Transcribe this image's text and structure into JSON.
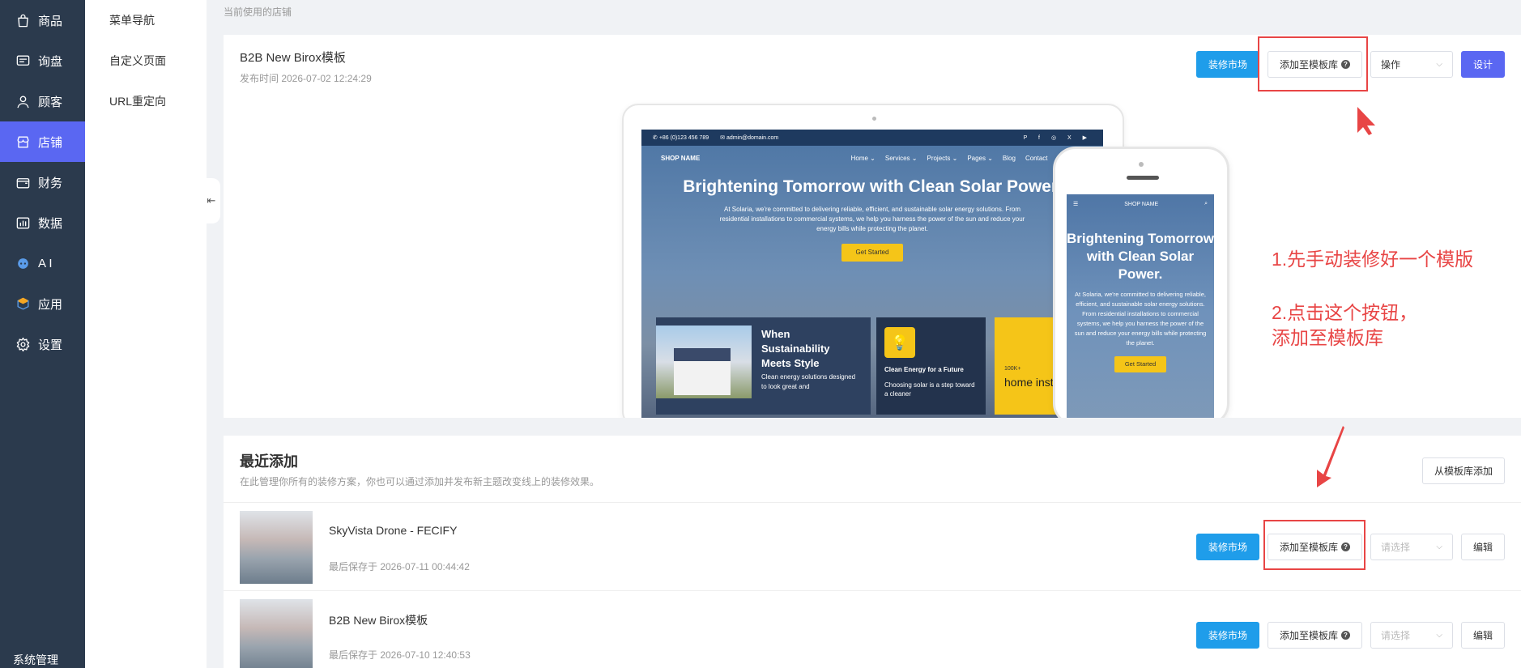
{
  "sidebar": {
    "items": [
      {
        "label": "商品",
        "icon": "bag-icon"
      },
      {
        "label": "询盘",
        "icon": "chat-icon"
      },
      {
        "label": "顾客",
        "icon": "user-icon"
      },
      {
        "label": "店铺",
        "icon": "store-icon",
        "active": true
      },
      {
        "label": "财务",
        "icon": "wallet-icon"
      },
      {
        "label": "数据",
        "icon": "chart-icon"
      },
      {
        "label": "A I",
        "icon": "robot-icon"
      },
      {
        "label": "应用",
        "icon": "cube-icon"
      },
      {
        "label": "设置",
        "icon": "gear-icon"
      }
    ],
    "footer": "系统管理",
    "active_color": "#5a67f2"
  },
  "subnav": {
    "items": [
      "菜单导航",
      "自定义页面",
      "URL重定向"
    ]
  },
  "breadcrumb": "当前使用的店铺",
  "current_store": {
    "title": "B2B New Birox模板",
    "date": "发布时间 2026-07-02 12:24:29",
    "buttons": {
      "market": "装修市场",
      "add_library": "添加至模板库",
      "operation": "操作",
      "design": "设计"
    }
  },
  "preview": {
    "tablet": {
      "phone_number": "+86 (0)123 456 789",
      "email": "admin@domain.com",
      "social": "P f ◎ X ▶",
      "shop_name": "SHOP NAME",
      "nav_links": [
        "Home ⌄",
        "Services ⌄",
        "Projects ⌄",
        "Pages ⌄",
        "Blog",
        "Contact"
      ],
      "headline": "Brightening Tomorrow with Clean Solar Power.",
      "body": "At Solaria, we're committed to delivering reliable, efficient, and sustainable solar energy solutions. From residential installations to commercial systems, we help you harness the power of the sun and reduce your energy bills while protecting the planet.",
      "cta": "Get Started",
      "panel1_title": "When Sustainability Meets Style",
      "panel1_sub": "Clean energy solutions designed to look great and",
      "panel2_title": "Clean Energy for a Future",
      "panel2_sub": "Choosing solar is a step toward a cleaner",
      "panel3_small": "100K+",
      "panel3_title": "home instal"
    },
    "phone": {
      "shop_name": "SHOP NAME",
      "headline": "Brightening Tomorrow with Clean Solar Power.",
      "body": "At Solaria, we're committed to delivering reliable, efficient, and sustainable solar energy solutions. From residential installations to commercial systems, we help you harness the power of the sun and reduce your energy bills while protecting the planet.",
      "cta": "Get Started"
    }
  },
  "annotations": {
    "note1": "1.先手动装修好一个模版",
    "note2_line1": "2.点击这个按钮，",
    "note2_line2": "添加至模板库",
    "color": "#e84545"
  },
  "recent": {
    "title": "最近添加",
    "desc": "在此管理你所有的装修方案，你也可以通过添加并发布新主题改变线上的装修效果。",
    "from_library": "从模板库添加",
    "rows": [
      {
        "title": "SkyVista Drone - FECIFY",
        "date": "最后保存于 2026-07-11 00:44:42",
        "market": "装修市场",
        "add_library": "添加至模板库",
        "select": "请选择",
        "edit": "编辑"
      },
      {
        "title": "B2B New Birox模板",
        "date": "最后保存于 2026-07-10 12:40:53",
        "market": "装修市场",
        "add_library": "添加至模板库",
        "select": "请选择",
        "edit": "编辑"
      }
    ]
  }
}
